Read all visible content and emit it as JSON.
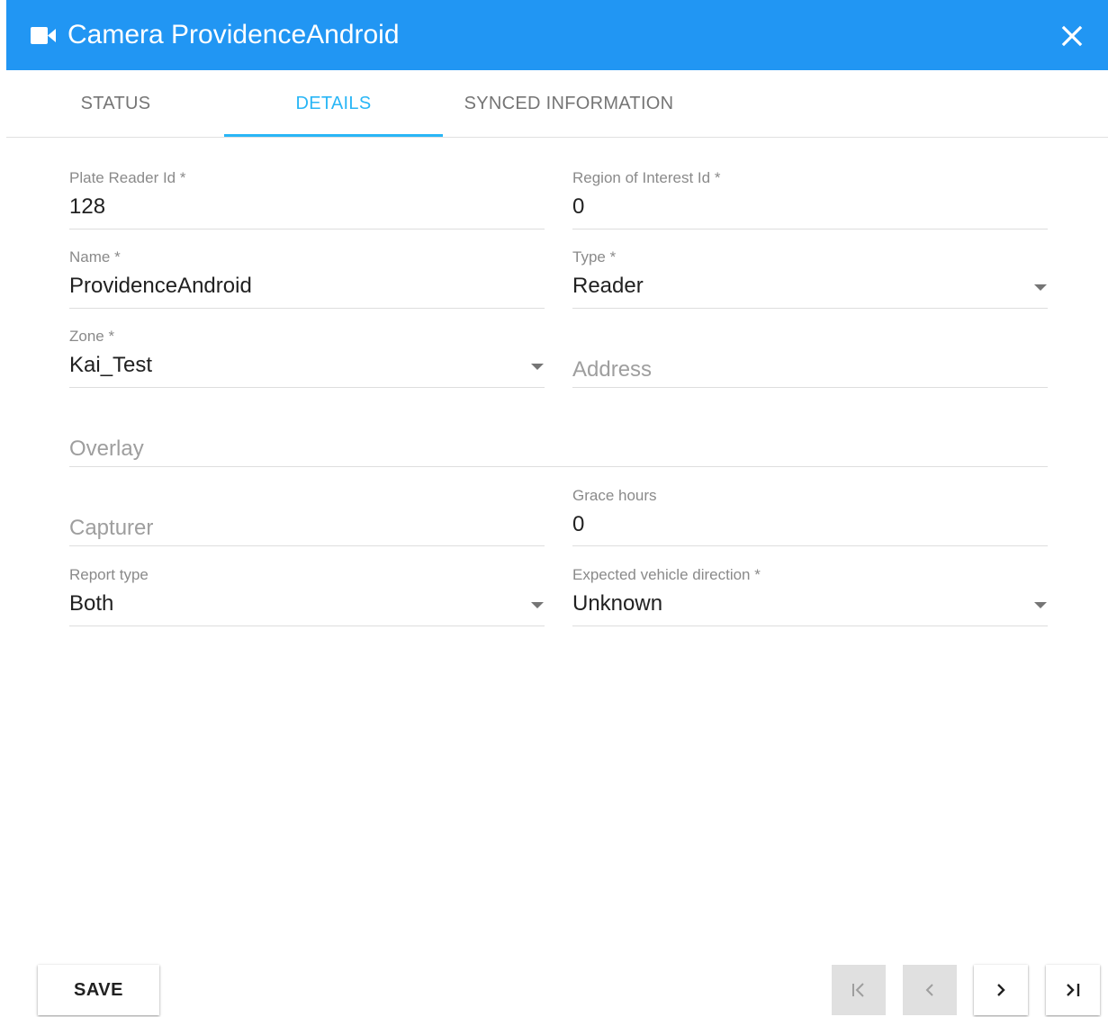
{
  "header": {
    "title": "Camera ProvidenceAndroid",
    "icon": "video-camera-icon",
    "close_icon": "close-icon",
    "background_color": "#2196f3"
  },
  "tabs": [
    {
      "label": "STATUS",
      "active": false
    },
    {
      "label": "DETAILS",
      "active": true
    },
    {
      "label": "SYNCED INFORMATION",
      "active": false
    }
  ],
  "accent_color": "#29b6f6",
  "form": {
    "plate_reader_id": {
      "label": "Plate Reader Id *",
      "value": "128"
    },
    "region_of_interest_id": {
      "label": "Region of Interest Id *",
      "value": "0"
    },
    "name": {
      "label": "Name *",
      "value": "ProvidenceAndroid"
    },
    "type": {
      "label": "Type *",
      "value": "Reader"
    },
    "zone": {
      "label": "Zone *",
      "value": "Kai_Test"
    },
    "address": {
      "placeholder": "Address",
      "value": ""
    },
    "overlay": {
      "placeholder": "Overlay",
      "value": ""
    },
    "capturer": {
      "placeholder": "Capturer",
      "value": ""
    },
    "grace_hours": {
      "label": "Grace hours",
      "value": "0"
    },
    "report_type": {
      "label": "Report type",
      "value": "Both"
    },
    "expected_vehicle_direction": {
      "label": "Expected vehicle direction *",
      "value": "Unknown"
    }
  },
  "footer": {
    "save_label": "SAVE",
    "nav": [
      {
        "name": "first-page",
        "icon": "first-page-icon",
        "enabled": false
      },
      {
        "name": "previous-page",
        "icon": "chevron-left-icon",
        "enabled": false
      },
      {
        "name": "next-page",
        "icon": "chevron-right-icon",
        "enabled": true
      },
      {
        "name": "last-page",
        "icon": "last-page-icon",
        "enabled": true
      }
    ]
  }
}
